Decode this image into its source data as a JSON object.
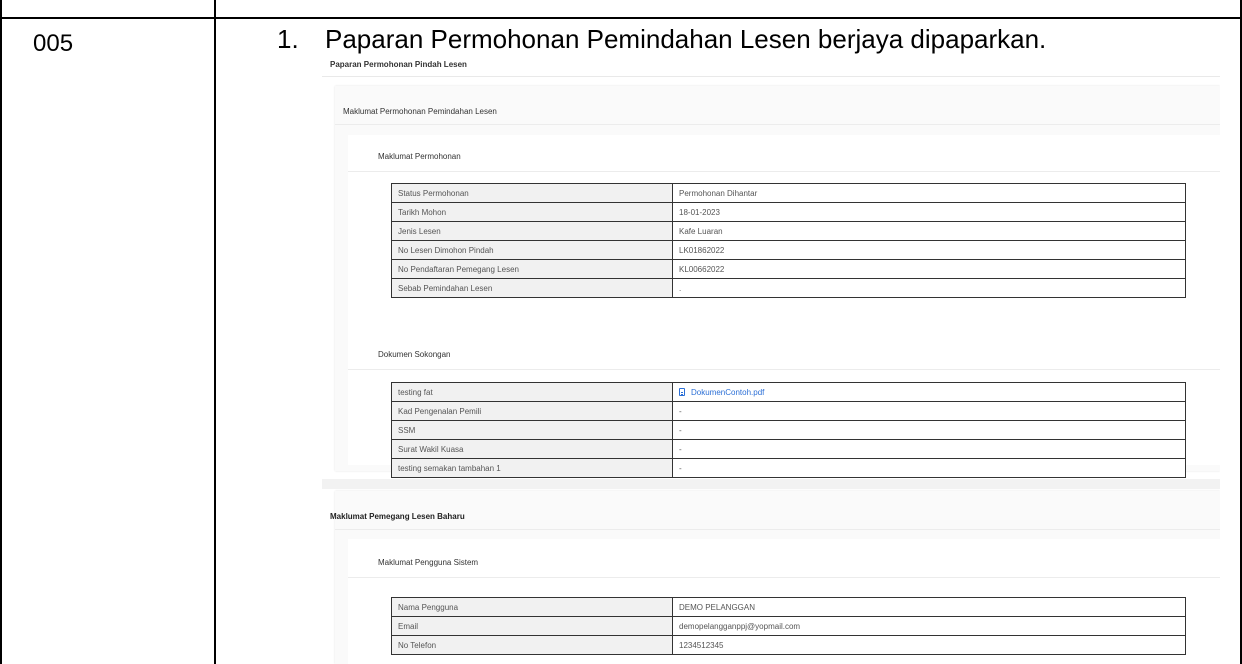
{
  "row": {
    "case_id": "005",
    "step_number": "1.",
    "step_text": "Paparan Permohonan Pemindahan Lesen berjaya dipaparkan."
  },
  "screen": {
    "page_title": "Paparan Permohonan Pindah Lesen",
    "card1": {
      "title": "Maklumat Permohonan Pemindahan Lesen",
      "section1_title": "Maklumat Permohonan",
      "section1_rows": [
        {
          "label": "Status Permohonan",
          "value": "Permohonan Dihantar"
        },
        {
          "label": "Tarikh Mohon",
          "value": "18-01-2023"
        },
        {
          "label": "Jenis Lesen",
          "value": "Kafe Luaran"
        },
        {
          "label": "No Lesen Dimohon Pindah",
          "value": "LK01862022"
        },
        {
          "label": "No Pendaftaran Pemegang Lesen",
          "value": "KL00662022"
        },
        {
          "label": "Sebab Pemindahan Lesen",
          "value": "."
        }
      ],
      "section2_title": "Dokumen Sokongan",
      "section2_rows": [
        {
          "label": "testing fat",
          "value": "DokumenContoh.pdf",
          "icon": "file-icon"
        },
        {
          "label": "Kad Pengenalan Pemili",
          "value": "-"
        },
        {
          "label": "SSM",
          "value": "-"
        },
        {
          "label": "Surat Wakil Kuasa",
          "value": "-"
        },
        {
          "label": "testing semakan tambahan 1",
          "value": "-"
        }
      ]
    },
    "card2": {
      "title": "Maklumat Pemegang Lesen Baharu",
      "section1_title": "Maklumat Pengguna Sistem",
      "section1_rows": [
        {
          "label": "Nama Pengguna",
          "value": "DEMO PELANGGAN"
        },
        {
          "label": "Email",
          "value": "demopelangganppj@yopmail.com"
        },
        {
          "label": "No Telefon",
          "value": "1234512345"
        }
      ]
    },
    "colors": {
      "link": "#2b6fd6",
      "label_bg": "#f1f1f1",
      "border": "#333333"
    }
  }
}
